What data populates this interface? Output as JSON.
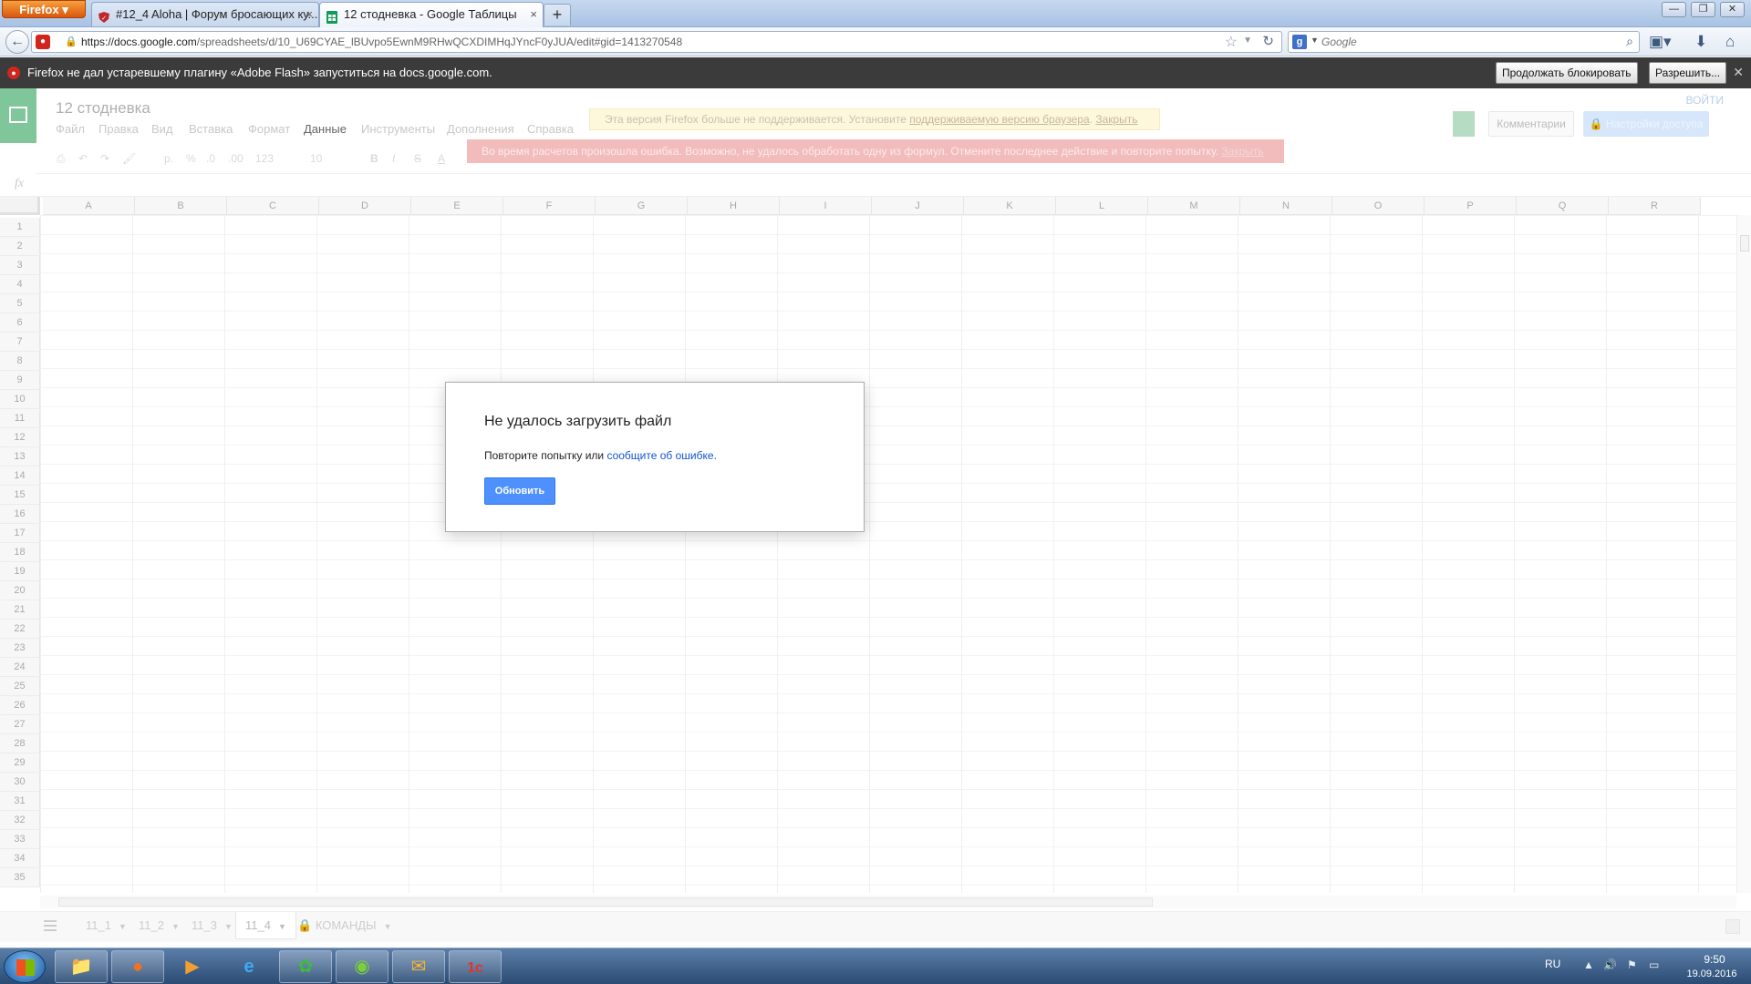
{
  "browser": {
    "firefox_button": "Firefox",
    "tabs": [
      {
        "title": "#12_4 Aloha | Форум бросающих ку...",
        "active": false
      },
      {
        "title": "12 стодневка - Google Таблицы",
        "active": true
      }
    ],
    "new_tab": "+",
    "url_host": "https://docs.google.com",
    "url_path": "/spreadsheets/d/10_U69CYAE_lBUvpo5EwnM9RHwQCXDIMHqJYncF0yJUA/edit#gid=1413270548",
    "search_placeholder": "Google",
    "window_controls": {
      "minimize": "—",
      "restore": "❐",
      "close": "✕"
    }
  },
  "notification": {
    "message": "Firefox не дал устаревшему плагину «Adobe Flash» запуститься на docs.google.com.",
    "continue_blocking": "Продолжать блокировать",
    "allow": "Разрешить...",
    "close": "✕"
  },
  "sheets": {
    "doc_title": "12 стодневка",
    "menu": [
      "Файл",
      "Правка",
      "Вид",
      "Вставка",
      "Формат",
      "Данные",
      "Инструменты",
      "Дополнения",
      "Справка"
    ],
    "active_menu_index": 5,
    "sign_in": "ВОЙТИ",
    "comments_button": "Комментарии",
    "access_button": "Настройки доступа",
    "yellow_notice": {
      "text": "Эта версия Firefox больше не поддерживается. Установите ",
      "link": "поддерживаемую версию браузера",
      "close": "Закрыть"
    },
    "red_notice": {
      "text": "Во время расчетов произошла ошибка. Возможно, не удалось обработать одну из формул. Отмените последнее действие и повторите попытку.",
      "close": "Закрыть"
    },
    "toolbar": {
      "currency": "р.",
      "percent": "%",
      "dec1": ".0",
      "dec2": ".00",
      "format_123": "123",
      "font_size": "10",
      "bold": "B",
      "italic": "I",
      "strike": "S",
      "text_color": "A"
    },
    "fx_label": "fx",
    "columns": [
      "A",
      "B",
      "C",
      "D",
      "E",
      "F",
      "G",
      "H",
      "I",
      "J",
      "K",
      "L",
      "M",
      "N",
      "O",
      "P",
      "Q",
      "R"
    ],
    "rows": [
      "1",
      "2",
      "3",
      "4",
      "5",
      "6",
      "7",
      "8",
      "9",
      "10",
      "11",
      "12",
      "13",
      "14",
      "15",
      "16",
      "17",
      "18",
      "19",
      "20",
      "21",
      "22",
      "23",
      "24",
      "25",
      "26",
      "27",
      "28",
      "29",
      "30",
      "31",
      "32",
      "33",
      "34",
      "35"
    ],
    "sheet_tabs": [
      {
        "name": "11_1",
        "active": false
      },
      {
        "name": "11_2",
        "active": false
      },
      {
        "name": "11_3",
        "active": false
      },
      {
        "name": "11_4",
        "active": true
      },
      {
        "name": "КОМАНДЫ",
        "active": false,
        "locked": true
      }
    ]
  },
  "dialog": {
    "title": "Не удалось загрузить файл",
    "body": "Повторите попытку или ",
    "link": "сообщите об ошибке.",
    "button": "Обновить"
  },
  "taskbar": {
    "apps": [
      "explorer",
      "firefox",
      "media-player",
      "ie",
      "icq",
      "qip",
      "outlook",
      "1c"
    ],
    "language": "RU",
    "time": "9:50",
    "date": "19.09.2016"
  },
  "colors": {
    "accent_blue": "#4d90fe",
    "link_blue": "#1155cc",
    "sheets_green": "#7fc79b",
    "error_red": "#f2bcbc"
  }
}
